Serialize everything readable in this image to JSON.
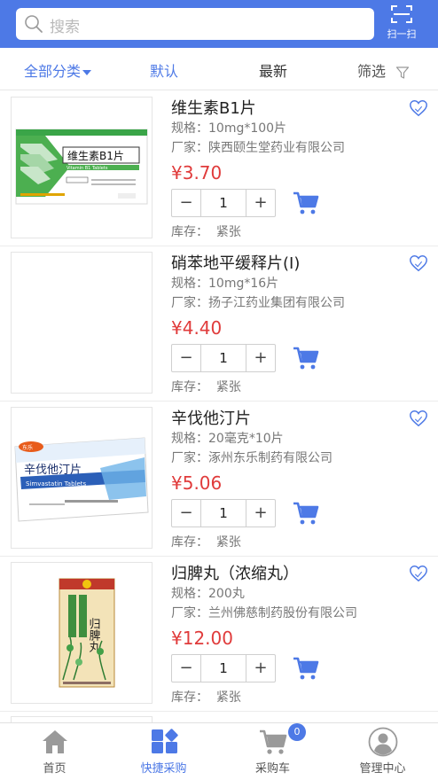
{
  "header": {
    "search_placeholder": "搜索",
    "scan_label": "扫一扫"
  },
  "filter": {
    "category": "全部分类",
    "default": "默认",
    "newest": "最新",
    "filter": "筛选"
  },
  "labels": {
    "spec_prefix": "规格：",
    "maker_prefix": "厂家：",
    "stock_prefix": "库存：",
    "minus": "−",
    "plus": "+"
  },
  "products": [
    {
      "name": "维生素B1片",
      "spec": "10mg*100片",
      "maker": "陕西颐生堂药业有限公司",
      "price": "¥3.70",
      "quantity": "1",
      "stock": "紧张"
    },
    {
      "name": "硝苯地平缓释片(Ⅰ)",
      "spec": "10mg*16片",
      "maker": "扬子江药业集团有限公司",
      "price": "¥4.40",
      "quantity": "1",
      "stock": "紧张"
    },
    {
      "name": "辛伐他汀片",
      "spec": "20毫克*10片",
      "maker": "涿州东乐制药有限公司",
      "price": "¥5.06",
      "quantity": "1",
      "stock": "紧张"
    },
    {
      "name": "归脾丸（浓缩丸）",
      "spec": "200丸",
      "maker": "兰州佛慈制药股份有限公司",
      "price": "¥12.00",
      "quantity": "1",
      "stock": "紧张"
    }
  ],
  "package_text": {
    "vitb1": "维生素B1片",
    "vitb1_en": "Vitamin B1 Tablets",
    "simva": "辛伐他汀片",
    "simva_en": "Simvastatin Tablets",
    "guipi": "归脾丸"
  },
  "tabbar": {
    "home": "首页",
    "quick_purchase": "快捷采购",
    "cart": "采购车",
    "cart_count": "0",
    "admin": "管理中心"
  },
  "colors": {
    "brand": "#4D79E6",
    "price": "#e03b3b"
  }
}
